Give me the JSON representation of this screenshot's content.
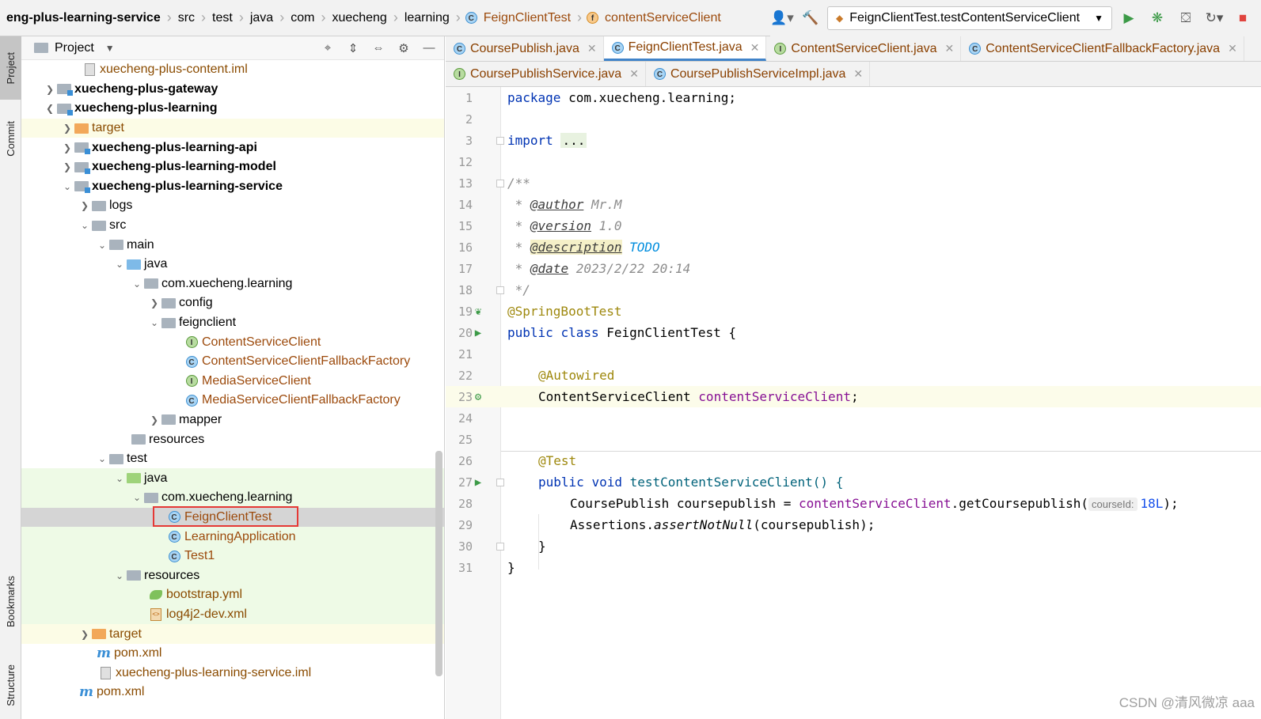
{
  "breadcrumb": {
    "items": [
      "eng-plus-learning-service",
      "src",
      "test",
      "java",
      "com",
      "xuecheng",
      "learning",
      "FeignClientTest",
      "contentServiceClient"
    ]
  },
  "toolbar": {
    "run_config": "FeignClientTest.testContentServiceClient"
  },
  "left_strip": {
    "project": "Project",
    "commit": "Commit",
    "bookmarks": "Bookmarks",
    "structure": "Structure"
  },
  "project_panel": {
    "title": "Project"
  },
  "tree": [
    {
      "label": "xuecheng-plus-content.iml",
      "style": "dark-orange"
    },
    {
      "label": "xuecheng-plus-gateway",
      "style": "bold"
    },
    {
      "label": "xuecheng-plus-learning",
      "style": "bold"
    },
    {
      "label": "target",
      "style": "dark-orange"
    },
    {
      "label": "xuecheng-plus-learning-api",
      "style": "bold"
    },
    {
      "label": "xuecheng-plus-learning-model",
      "style": "bold"
    },
    {
      "label": "xuecheng-plus-learning-service",
      "style": "bold"
    },
    {
      "label": "logs"
    },
    {
      "label": "src"
    },
    {
      "label": "main"
    },
    {
      "label": "java"
    },
    {
      "label": "com.xuecheng.learning"
    },
    {
      "label": "config"
    },
    {
      "label": "feignclient"
    },
    {
      "label": "ContentServiceClient",
      "style": "orange"
    },
    {
      "label": "ContentServiceClientFallbackFactory",
      "style": "orange"
    },
    {
      "label": "MediaServiceClient",
      "style": "orange"
    },
    {
      "label": "MediaServiceClientFallbackFactory",
      "style": "orange"
    },
    {
      "label": "mapper"
    },
    {
      "label": "resources"
    },
    {
      "label": "test"
    },
    {
      "label": "java"
    },
    {
      "label": "com.xuecheng.learning"
    },
    {
      "label": "FeignClientTest",
      "style": "orange"
    },
    {
      "label": "LearningApplication",
      "style": "orange"
    },
    {
      "label": "Test1",
      "style": "orange"
    },
    {
      "label": "resources"
    },
    {
      "label": "bootstrap.yml",
      "style": "dark-orange"
    },
    {
      "label": "log4j2-dev.xml",
      "style": "dark-orange"
    },
    {
      "label": "target",
      "style": "dark-orange"
    },
    {
      "label": "pom.xml",
      "style": "dark-orange"
    },
    {
      "label": "xuecheng-plus-learning-service.iml",
      "style": "dark-orange"
    },
    {
      "label": "pom.xml",
      "style": "dark-orange"
    }
  ],
  "tabs_row1": [
    {
      "label": "CoursePublish.java",
      "badge": "C"
    },
    {
      "label": "FeignClientTest.java",
      "badge": "C"
    },
    {
      "label": "ContentServiceClient.java",
      "badge": "I"
    },
    {
      "label": "ContentServiceClientFallbackFactory.java",
      "badge": "C"
    }
  ],
  "tabs_row2": [
    {
      "label": "CoursePublishService.java",
      "badge": "I"
    },
    {
      "label": "CoursePublishServiceImpl.java",
      "badge": "C"
    }
  ],
  "code": {
    "line_numbers": [
      "1",
      "2",
      "3",
      "12",
      "13",
      "14",
      "15",
      "16",
      "17",
      "18",
      "19",
      "20",
      "21",
      "22",
      "23",
      "24",
      "25",
      "26",
      "27",
      "28",
      "29",
      "30",
      "31"
    ],
    "l1_kw": "package",
    "l1_rest": " com.xuecheng.learning;",
    "l3_kw": "import",
    "l3_fold": "...",
    "l13": "/**",
    "l14_tag": "@author",
    "l14_val": " Mr.M",
    "l15_tag": "@version",
    "l15_val": " 1.0",
    "l16_tag": "@description",
    "l16_val": " TODO",
    "l17_tag": "@date",
    "l17_val": " 2023/2/22 20:14",
    "l18": " */",
    "l19": "@SpringBootTest",
    "l20_kw1": "public",
    "l20_kw2": "class",
    "l20_rest": " FeignClientTest {",
    "l22": "@Autowired",
    "l23_type": "ContentServiceClient ",
    "l23_field": "contentServiceClient",
    "l23_end": ";",
    "l26": "@Test",
    "l27_kw1": "public",
    "l27_kw2": "void",
    "l27_rest": " testContentServiceClient() {",
    "l28_a": "CoursePublish coursepublish = ",
    "l28_field": "contentServiceClient",
    "l28_b": ".getCoursepublish(",
    "l28_hint": "courseId:",
    "l28_num": "18L",
    "l28_end": ");",
    "l29_a": "Assertions.",
    "l29_method": "assertNotNull",
    "l29_b": "(coursepublish);",
    "l30": "}",
    "l31": "}"
  },
  "watermark": "CSDN @清风微凉 aaa"
}
